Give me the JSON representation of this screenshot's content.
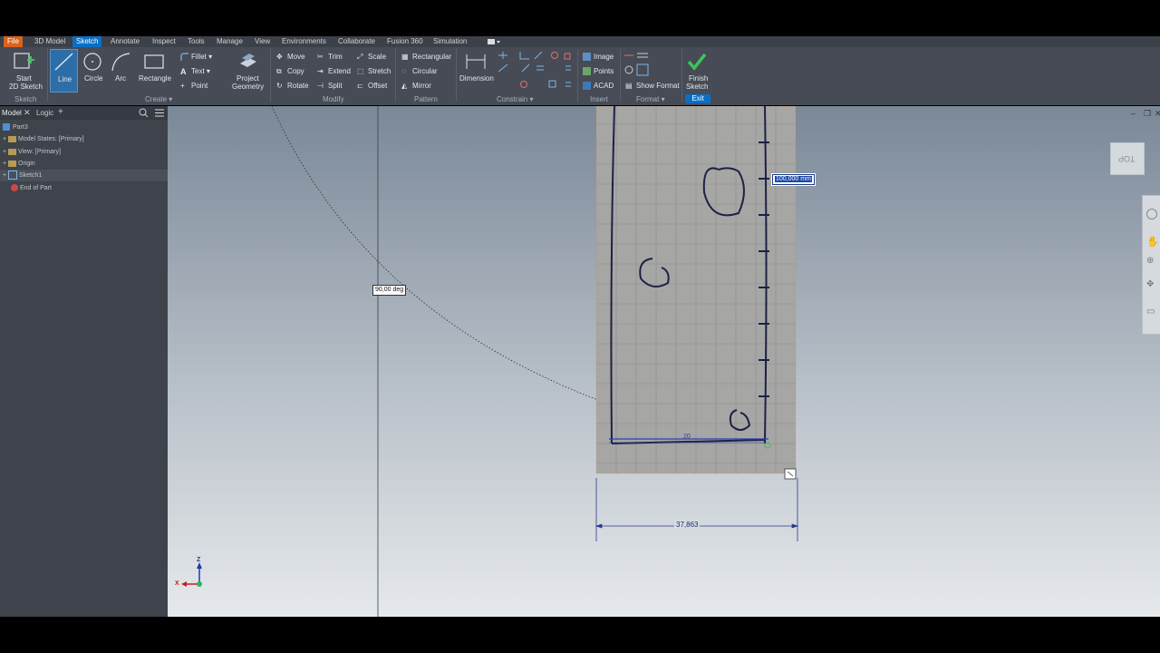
{
  "menu_tabs": [
    "File",
    "3D Model",
    "Sketch",
    "Annotate",
    "Inspect",
    "Tools",
    "Manage",
    "View",
    "Environments",
    "Collaborate",
    "Fusion 360",
    "Simulation"
  ],
  "ribbon": {
    "sketch": {
      "start_line1": "Start",
      "start_line2": "2D Sketch",
      "group": "Sketch"
    },
    "create": {
      "line": "Line",
      "circle": "Circle",
      "arc": "Arc",
      "rectangle": "Rectangle",
      "fillet": "Fillet",
      "text": "Text",
      "point": "Point",
      "project_line1": "Project",
      "project_line2": "Geometry",
      "group": "Create"
    },
    "modify": {
      "move": "Move",
      "trim": "Trim",
      "scale": "Scale",
      "copy": "Copy",
      "extend": "Extend",
      "stretch": "Stretch",
      "rotate": "Rotate",
      "split": "Split",
      "offset": "Offset",
      "group": "Modify"
    },
    "pattern": {
      "rectangular": "Rectangular",
      "circular": "Circular",
      "mirror": "Mirror",
      "group": "Pattern"
    },
    "constrain": {
      "dimension": "Dimension",
      "group": "Constrain"
    },
    "insert": {
      "image": "Image",
      "points": "Points",
      "acad": "ACAD",
      "group": "Insert"
    },
    "format": {
      "show_format": "Show Format",
      "group": "Format"
    },
    "exit": {
      "finish_line1": "Finish",
      "finish_line2": "Sketch",
      "group": "Exit"
    }
  },
  "browser": {
    "tabs": [
      "Model",
      "Logic"
    ],
    "tree": [
      "Part3",
      "Model States: [Primary]",
      "View: [Primary]",
      "Origin",
      "Sketch1",
      "End of Part"
    ]
  },
  "viewport": {
    "angle_label": "90,00 deg",
    "length_input": "100,000 mm",
    "width_dim": "37,863",
    "inner_dim": "20",
    "viewcube_label": "TOP",
    "triad_z": "Z",
    "triad_x": "X"
  },
  "colors": {
    "accent": "#0a6fc4",
    "file_tab": "#d9621e",
    "finish_check": "#3cc35a"
  }
}
